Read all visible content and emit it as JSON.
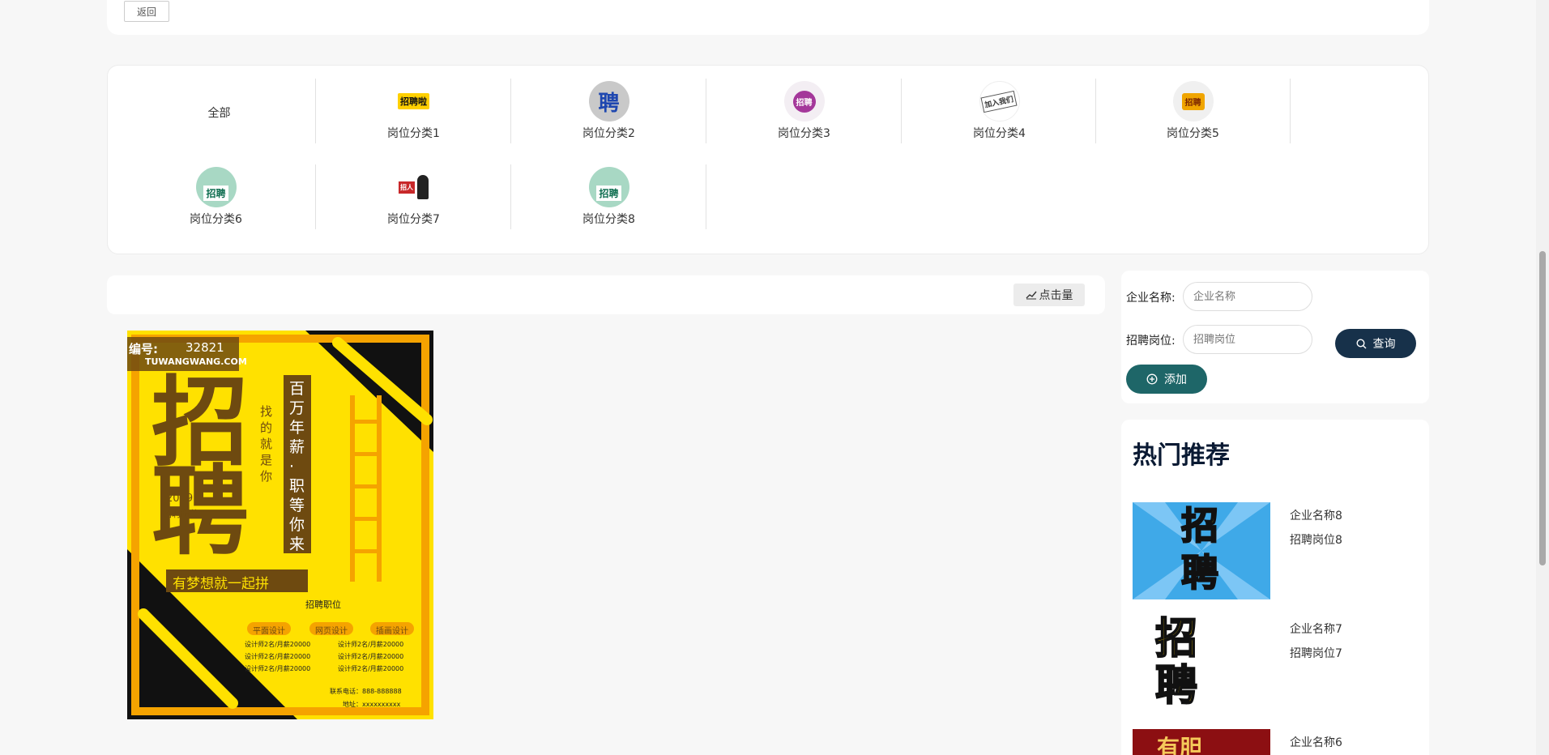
{
  "header": {
    "back_label": "返回"
  },
  "categories": {
    "all_label": "全部",
    "items": [
      {
        "label": "岗位分类1",
        "icon": "招聘啦"
      },
      {
        "label": "岗位分类2",
        "icon": "聘"
      },
      {
        "label": "岗位分类3",
        "icon": "招聘"
      },
      {
        "label": "岗位分类4",
        "icon": "加入我们"
      },
      {
        "label": "岗位分类5",
        "icon": "招聘"
      },
      {
        "label": "岗位分类6",
        "icon": "招聘"
      },
      {
        "label": "岗位分类7",
        "icon": "招人"
      },
      {
        "label": "岗位分类8",
        "icon": "招聘"
      }
    ]
  },
  "toolbar": {
    "sort_label": "点击量"
  },
  "poster": {
    "id_label": "编号:",
    "id_number": "32821",
    "site": "TUWANGWANG.COM",
    "big_text": "招聘",
    "year": "2019",
    "subtitle": "招聘精英",
    "vertical_1": "找的就是你",
    "vertical_2": "百万年薪·职等你来",
    "slogan": "有梦想就一起拼",
    "positions_title": "招聘职位",
    "tags": [
      "平面设计",
      "网页设计",
      "插画设计"
    ],
    "lines": [
      "设计师2名/月薪20000",
      "设计师2名/月薪20000",
      "设计师2名/月薪20000",
      "设计师2名/月薪20000",
      "设计师2名/月薪20000",
      "设计师2名/月薪20000"
    ],
    "contact": "联系电话：888-888888",
    "address": "地址：xxxxxxxxxx"
  },
  "search": {
    "company_label": "企业名称:",
    "company_placeholder": "企业名称",
    "position_label": "招聘岗位:",
    "position_placeholder": "招聘岗位",
    "query_label": "查询",
    "add_label": "添加"
  },
  "hot": {
    "title": "热门推荐",
    "items": [
      {
        "company": "企业名称8",
        "position": "招聘岗位8",
        "img_text": "招聘"
      },
      {
        "company": "企业名称7",
        "position": "招聘岗位7",
        "img_text": "招聘"
      },
      {
        "company": "企业名称6",
        "position": "",
        "img_text": "有胆"
      }
    ]
  },
  "colors": {
    "query_btn": "#17314a",
    "add_btn": "#1e6668",
    "poster_yellow": "#ffe100",
    "hot_title": "#0a1a33"
  }
}
